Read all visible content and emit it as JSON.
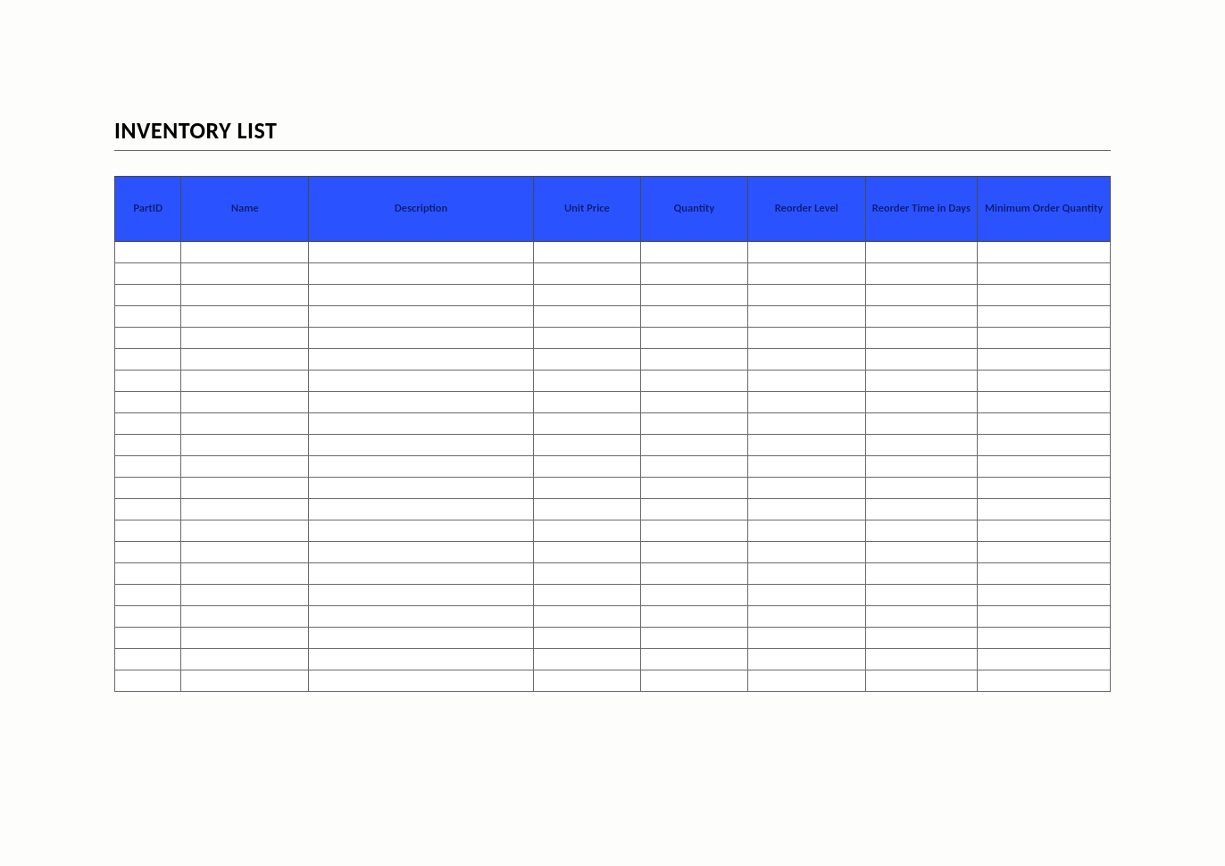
{
  "title": "INVENTORY LIST",
  "headers": {
    "partid": "PartID",
    "name": "Name",
    "desc": "Description",
    "price": "Unit Price",
    "qty": "Quantity",
    "reorder": "Reorder Level",
    "days": "Reorder Time in Days",
    "min": "Minimum Order Quantity"
  },
  "row_count": 21,
  "rows": [
    [
      "",
      "",
      "",
      "",
      "",
      "",
      "",
      ""
    ],
    [
      "",
      "",
      "",
      "",
      "",
      "",
      "",
      ""
    ],
    [
      "",
      "",
      "",
      "",
      "",
      "",
      "",
      ""
    ],
    [
      "",
      "",
      "",
      "",
      "",
      "",
      "",
      ""
    ],
    [
      "",
      "",
      "",
      "",
      "",
      "",
      "",
      ""
    ],
    [
      "",
      "",
      "",
      "",
      "",
      "",
      "",
      ""
    ],
    [
      "",
      "",
      "",
      "",
      "",
      "",
      "",
      ""
    ],
    [
      "",
      "",
      "",
      "",
      "",
      "",
      "",
      ""
    ],
    [
      "",
      "",
      "",
      "",
      "",
      "",
      "",
      ""
    ],
    [
      "",
      "",
      "",
      "",
      "",
      "",
      "",
      ""
    ],
    [
      "",
      "",
      "",
      "",
      "",
      "",
      "",
      ""
    ],
    [
      "",
      "",
      "",
      "",
      "",
      "",
      "",
      ""
    ],
    [
      "",
      "",
      "",
      "",
      "",
      "",
      "",
      ""
    ],
    [
      "",
      "",
      "",
      "",
      "",
      "",
      "",
      ""
    ],
    [
      "",
      "",
      "",
      "",
      "",
      "",
      "",
      ""
    ],
    [
      "",
      "",
      "",
      "",
      "",
      "",
      "",
      ""
    ],
    [
      "",
      "",
      "",
      "",
      "",
      "",
      "",
      ""
    ],
    [
      "",
      "",
      "",
      "",
      "",
      "",
      "",
      ""
    ],
    [
      "",
      "",
      "",
      "",
      "",
      "",
      "",
      ""
    ],
    [
      "",
      "",
      "",
      "",
      "",
      "",
      "",
      ""
    ],
    [
      "",
      "",
      "",
      "",
      "",
      "",
      "",
      ""
    ]
  ]
}
